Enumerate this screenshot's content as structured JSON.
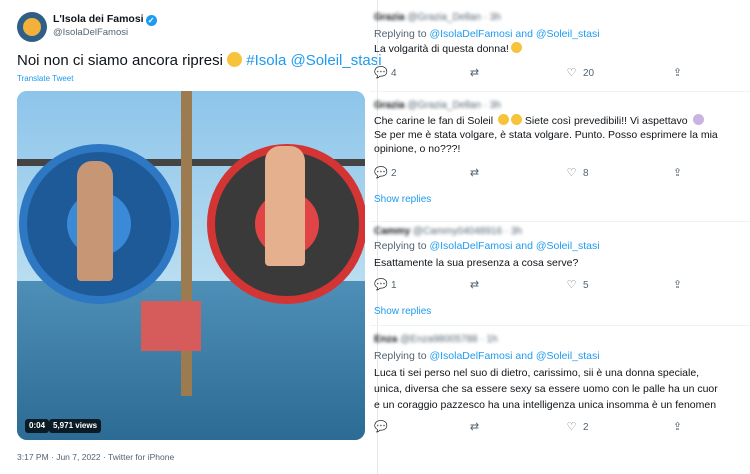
{
  "main_tweet": {
    "author": "L'Isola dei Famosi",
    "handle": "@IsolaDelFamosi",
    "text_plain": "Noi non ci siamo ancora ripresi",
    "text_hashtag": "#Isola",
    "text_mention": "@Soleil_stasi",
    "translate": "Translate Tweet",
    "video_duration": "0:04",
    "video_views": "5,971 views",
    "meta": "3:17 PM · Jun 7, 2022 · Twitter for iPhone"
  },
  "replies": [
    {
      "name": "Grazia",
      "handle": "@Grazia_Dellan · 3h",
      "replying_prefix": "Replying to",
      "replying_to": "@IsolaDelFamosi and @Soleil_stasi",
      "body": [
        "La volgarità di questa donna!"
      ],
      "actions": {
        "reply": "4",
        "retweet": "",
        "like": "20"
      }
    },
    {
      "name": "Grazia",
      "handle": "@Grazia_Dellan · 3h",
      "replying_prefix": "",
      "replying_to": "",
      "body": [
        "Che carine le fan di Soleil",
        "Se per me è stata volgare, è stata volgare. Punto. Posso esprimere la mia",
        "opinione, o no???!"
      ],
      "body_inline": "Siete così prevedibili!! Vi aspettavo",
      "actions": {
        "reply": "2",
        "retweet": "",
        "like": "8"
      },
      "show_replies": "Show replies"
    },
    {
      "name": "Cammy",
      "handle": "@Cammy04048916 · 3h",
      "replying_prefix": "Replying to",
      "replying_to": "@IsolaDelFamosi and @Soleil_stasi",
      "body": [
        "Esattamente la sua presenza a cosa serve?"
      ],
      "actions": {
        "reply": "1",
        "retweet": "",
        "like": "5"
      },
      "show_replies": "Show replies"
    },
    {
      "name": "Enza",
      "handle": "@Enza98005788 · 1h",
      "replying_prefix": "Replying to",
      "replying_to": "@IsolaDelFamosi and @Soleil_stasi",
      "body": [
        "Luca ti sei perso nel suo di dietro,  carissimo, sii è  una donna speciale,",
        "unica, diversa che sa essere sexy  sa essere uomo con le palle ha un cuor",
        "e un coraggio pazzesco ha una intelligenza unica insomma è  un fenomen"
      ],
      "actions": {
        "reply": "",
        "retweet": "",
        "like": "2"
      }
    }
  ],
  "icons": {
    "reply": "comment-icon",
    "retweet": "retweet-icon",
    "like": "heart-icon",
    "share": "share-icon"
  },
  "colors": {
    "accent": "#1d9bf0",
    "text": "#0f1419",
    "muted": "#536471"
  }
}
